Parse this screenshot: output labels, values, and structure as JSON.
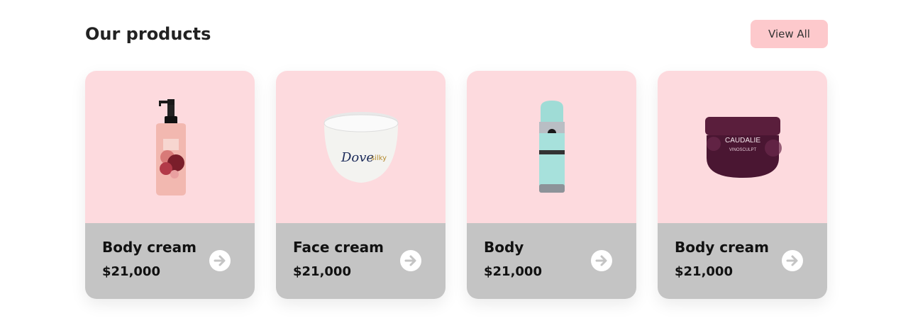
{
  "section": {
    "title": "Our products",
    "view_all_label": "View All"
  },
  "colors": {
    "accent": "#fdc9cc",
    "card_top": "#fddade",
    "card_bottom": "#c4c4c4"
  },
  "products": [
    {
      "name": "Body cream",
      "price": "$21,000",
      "image": "serum-pump-bottle-image",
      "icon": "arrow-right-circle-icon"
    },
    {
      "name": "Face cream",
      "price": "$21,000",
      "image": "dove-cream-jar-image",
      "brand_text": "Dove",
      "brand_sub": "silky",
      "icon": "arrow-right-circle-icon"
    },
    {
      "name": "Body",
      "price": "$21,000",
      "image": "body-spray-can-image",
      "icon": "arrow-right-circle-icon"
    },
    {
      "name": "Body cream",
      "price": "$21,000",
      "image": "caudalie-cream-jar-image",
      "brand_text": "CAUDALIE",
      "brand_sub": "VINOSCULPT",
      "icon": "arrow-right-circle-icon"
    }
  ]
}
